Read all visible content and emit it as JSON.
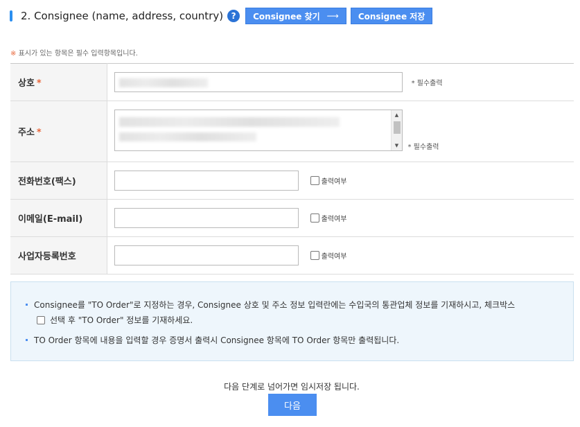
{
  "section": {
    "title": "2. Consignee (name, address, country)",
    "help_icon": "help-question-icon",
    "buttons": {
      "find": "Consignee 찾기",
      "save": "Consignee 저장"
    }
  },
  "required_note": "표시가 있는 항목은 필수 입력항목입니다.",
  "required_note_mark": "※",
  "required_mark": "*",
  "form": {
    "rows": [
      {
        "label": "상호",
        "required": true,
        "required_tag": "* 필수출력"
      },
      {
        "label": "주소",
        "required": true,
        "required_tag": "* 필수출력"
      },
      {
        "label": "전화번호(팩스)",
        "checkbox": "출력여부"
      },
      {
        "label": "이메일(E-mail)",
        "checkbox": "출력여부"
      },
      {
        "label": "사업자등록번호",
        "checkbox": "출력여부"
      }
    ]
  },
  "info": {
    "line1": "Consignee를 \"TO Order\"로 지정하는 경우, Consignee 상호 및 주소 정보 입력란에는 수입국의 통관업체 정보를 기재하시고, 체크박스",
    "line1b": "선택 후 \"TO Order\" 정보를 기재하세요.",
    "line2": "TO Order 항목에 내용을 입력할 경우 증명서 출력시 Consignee 항목에 TO Order 항목만 출력됩니다."
  },
  "footer": {
    "note": "다음 단계로 넘어가면 임시저장 됩니다.",
    "next_button": "다음"
  },
  "colors": {
    "accent": "#4b8ef0",
    "required": "#e8663a",
    "info_bg": "#eef6fc"
  }
}
